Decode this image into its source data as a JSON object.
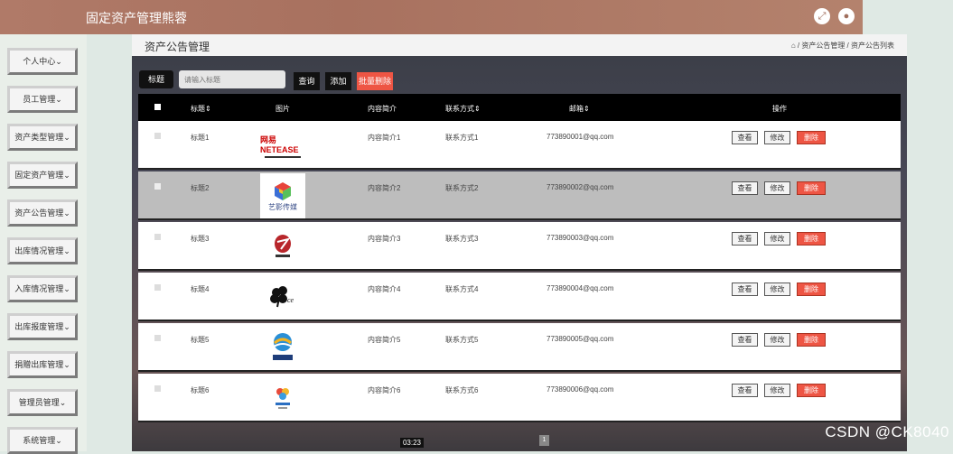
{
  "header": {
    "title": "固定资产管理熊蓉"
  },
  "sidebar": {
    "items": [
      {
        "label": "个人中心"
      },
      {
        "label": "员工管理"
      },
      {
        "label": "资产类型管理"
      },
      {
        "label": "固定资产管理"
      },
      {
        "label": "资产公告管理"
      },
      {
        "label": "出库情况管理"
      },
      {
        "label": "入库情况管理"
      },
      {
        "label": "出库报废管理"
      },
      {
        "label": "捐赠出库管理"
      },
      {
        "label": "管理员管理"
      },
      {
        "label": "系统管理"
      }
    ]
  },
  "page": {
    "title": "资产公告管理",
    "breadcrumb": "⌂ / 资产公告管理 / 资产公告列表"
  },
  "search": {
    "label": "标题",
    "placeholder": "请输入标题",
    "query_button": "查询",
    "add_button": "添加",
    "batch_delete_button": "批量删除"
  },
  "table": {
    "headers": [
      "标题⇕",
      "图片",
      "内容简介",
      "联系方式⇕",
      "邮箱⇕",
      "操作"
    ],
    "actions": {
      "view": "查看",
      "edit": "修改",
      "delete": "删除"
    },
    "rows": [
      {
        "title": "标题1",
        "image_label": "网易 NETEASE",
        "intro": "内容简介1",
        "contact": "联系方式1",
        "email": "773890001@qq.com"
      },
      {
        "title": "标题2",
        "image_label": "艺影传媒",
        "intro": "内容简介2",
        "contact": "联系方式2",
        "email": "773890002@qq.com"
      },
      {
        "title": "标题3",
        "image_label": "",
        "intro": "内容简介3",
        "contact": "联系方式3",
        "email": "773890003@qq.com"
      },
      {
        "title": "标题4",
        "image_label": "",
        "intro": "内容简介4",
        "contact": "联系方式4",
        "email": "773890004@qq.com"
      },
      {
        "title": "标题5",
        "image_label": "",
        "intro": "内容简介5",
        "contact": "联系方式5",
        "email": "773890005@qq.com"
      },
      {
        "title": "标题6",
        "image_label": "",
        "intro": "内容简介6",
        "contact": "联系方式6",
        "email": "773890006@qq.com"
      }
    ]
  },
  "footer": {
    "time": "03:23",
    "page": "1"
  },
  "watermark": "CSDN @CK8040"
}
